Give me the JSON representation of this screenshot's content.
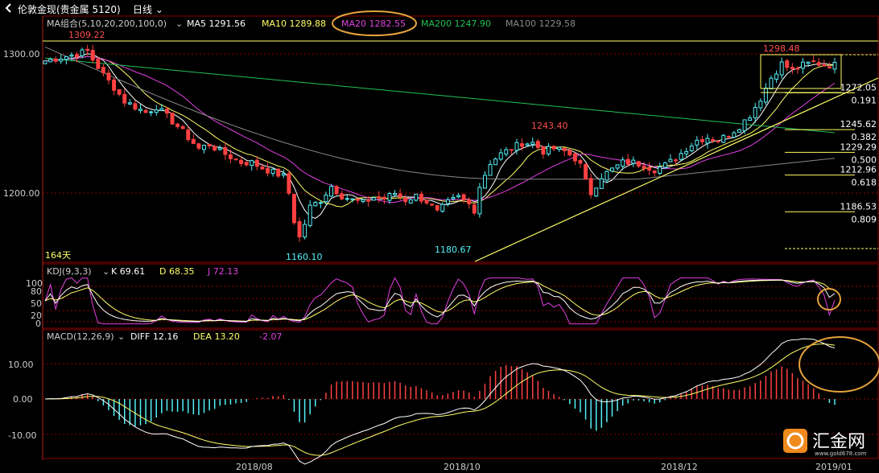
{
  "window": {
    "title": "伦敦金现(贵金属 5120)",
    "period": "日线",
    "back_icon": "back-arrow-icon",
    "dropdown_icon": "chevron-down-icon"
  },
  "colors": {
    "background": "#000000",
    "candle_up": "#54f0f8",
    "candle_down": "#ff4040",
    "ma5": "#ffffff",
    "ma10": "#ffff66",
    "ma20": "#e040e0",
    "ma200": "#22c055",
    "ma100": "#888888",
    "trendline": "#ffff66",
    "highlight_circle": "#e6a23c",
    "grid": "#8b0000"
  },
  "main_panel": {
    "legend": {
      "group": "MA组合(5,10,20,200,100,0)",
      "ma5": "MA5 1291.56",
      "ma10": "MA10 1289.88",
      "ma20": "MA20 1282.55",
      "ma200": "MA200 1247.90",
      "ma100": "MA100 1229.58"
    },
    "y_ticks": [
      "1300.00",
      "1200.00"
    ],
    "annotations": {
      "high_left": "1309.22",
      "low_main": "1160.10",
      "low_mid": "1180.67",
      "high_mid": "1243.40",
      "high_right": "1298.48",
      "bar_count": "164天"
    },
    "fib_levels": [
      {
        "price": "1272.05",
        "ratio": "0.191"
      },
      {
        "price": "1245.62",
        "ratio": "0.382"
      },
      {
        "price": "1229.29",
        "ratio": "0.500"
      },
      {
        "price": "1212.96",
        "ratio": "0.618"
      },
      {
        "price": "1186.53",
        "ratio": "0.809"
      }
    ]
  },
  "kdj_panel": {
    "legend": {
      "name": "KDJ(9,3,3)",
      "k": "K 69.61",
      "d": "D 68.35",
      "j": "J 72.13"
    },
    "y_ticks": [
      "100",
      "80",
      "50",
      "20",
      "0"
    ]
  },
  "macd_panel": {
    "legend": {
      "name": "MACD(12,26,9)",
      "diff": "DIFF 12.16",
      "dea": "DEA 13.20",
      "macd": "-2.07"
    },
    "y_ticks": [
      "10.00",
      "0.00",
      "-10.00"
    ]
  },
  "x_axis": [
    "2018/08",
    "2018/10",
    "2018/12",
    "2019/01"
  ],
  "watermark": {
    "brand": "汇金网",
    "url": "www.gold678.com"
  },
  "chart_data": {
    "type": "candlestick",
    "instrument": "伦敦金现",
    "price_ylim": [
      1150,
      1315
    ],
    "y_ticks": [
      1300,
      1200
    ],
    "x_labels": [
      "2018/08",
      "2018/10",
      "2018/12",
      "2019/01"
    ],
    "key_points": {
      "start_high": 1309.22,
      "low": 1160.1,
      "secondary_low": 1180.67,
      "mid_high": 1243.4,
      "recent_high": 1298.48
    },
    "moving_averages": [
      {
        "name": "MA5",
        "value": 1291.56
      },
      {
        "name": "MA10",
        "value": 1289.88
      },
      {
        "name": "MA20",
        "value": 1282.55
      },
      {
        "name": "MA200",
        "value": 1247.9
      },
      {
        "name": "MA100",
        "value": 1229.58
      }
    ],
    "fibonacci": [
      {
        "ratio": 0.191,
        "price": 1272.05
      },
      {
        "ratio": 0.382,
        "price": 1245.62
      },
      {
        "ratio": 0.5,
        "price": 1229.29
      },
      {
        "ratio": 0.618,
        "price": 1212.96
      },
      {
        "ratio": 0.809,
        "price": 1186.53
      }
    ],
    "price_path": [
      [
        0,
        1295
      ],
      [
        6,
        1300
      ],
      [
        8,
        1302
      ],
      [
        9,
        1296
      ],
      [
        11,
        1285
      ],
      [
        13,
        1276
      ],
      [
        15,
        1266
      ],
      [
        17,
        1262
      ],
      [
        19,
        1258
      ],
      [
        21,
        1262
      ],
      [
        23,
        1255
      ],
      [
        25,
        1248
      ],
      [
        27,
        1240
      ],
      [
        29,
        1232
      ],
      [
        31,
        1235
      ],
      [
        33,
        1230
      ],
      [
        35,
        1226
      ],
      [
        37,
        1222
      ],
      [
        39,
        1222
      ],
      [
        41,
        1218
      ],
      [
        43,
        1215
      ],
      [
        45,
        1212
      ],
      [
        46,
        1200
      ],
      [
        47,
        1180
      ],
      [
        48,
        1168
      ],
      [
        49,
        1178
      ],
      [
        50,
        1190
      ],
      [
        52,
        1195
      ],
      [
        54,
        1205
      ],
      [
        56,
        1198
      ],
      [
        58,
        1195
      ],
      [
        60,
        1193
      ],
      [
        62,
        1197
      ],
      [
        64,
        1196
      ],
      [
        66,
        1200
      ],
      [
        68,
        1195
      ],
      [
        70,
        1198
      ],
      [
        72,
        1194
      ],
      [
        74,
        1186
      ],
      [
        76,
        1193
      ],
      [
        78,
        1197
      ],
      [
        80,
        1192
      ],
      [
        81,
        1188
      ],
      [
        82,
        1205
      ],
      [
        84,
        1222
      ],
      [
        86,
        1228
      ],
      [
        88,
        1232
      ],
      [
        90,
        1236
      ],
      [
        92,
        1236
      ],
      [
        94,
        1230
      ],
      [
        96,
        1232
      ],
      [
        98,
        1230
      ],
      [
        100,
        1225
      ],
      [
        101,
        1220
      ],
      [
        102,
        1208
      ],
      [
        103,
        1200
      ],
      [
        105,
        1212
      ],
      [
        107,
        1217
      ],
      [
        109,
        1222
      ],
      [
        111,
        1222
      ],
      [
        113,
        1220
      ],
      [
        115,
        1217
      ],
      [
        117,
        1220
      ],
      [
        119,
        1225
      ],
      [
        121,
        1232
      ],
      [
        123,
        1238
      ],
      [
        125,
        1240
      ],
      [
        127,
        1238
      ],
      [
        129,
        1242
      ],
      [
        131,
        1248
      ],
      [
        133,
        1256
      ],
      [
        135,
        1268
      ],
      [
        137,
        1283
      ],
      [
        139,
        1293
      ],
      [
        141,
        1288
      ],
      [
        143,
        1292
      ],
      [
        145,
        1294
      ],
      [
        147,
        1292
      ],
      [
        149,
        1292
      ]
    ],
    "kdj": {
      "K": 69.61,
      "D": 68.35,
      "J": 72.13,
      "ylim": [
        0,
        100
      ],
      "y_ticks": [
        100,
        80,
        50,
        20,
        0
      ]
    },
    "macd": {
      "DIFF": 12.16,
      "DEA": 13.2,
      "MACD": -2.07,
      "y_ticks": [
        10,
        0,
        -10
      ]
    }
  }
}
